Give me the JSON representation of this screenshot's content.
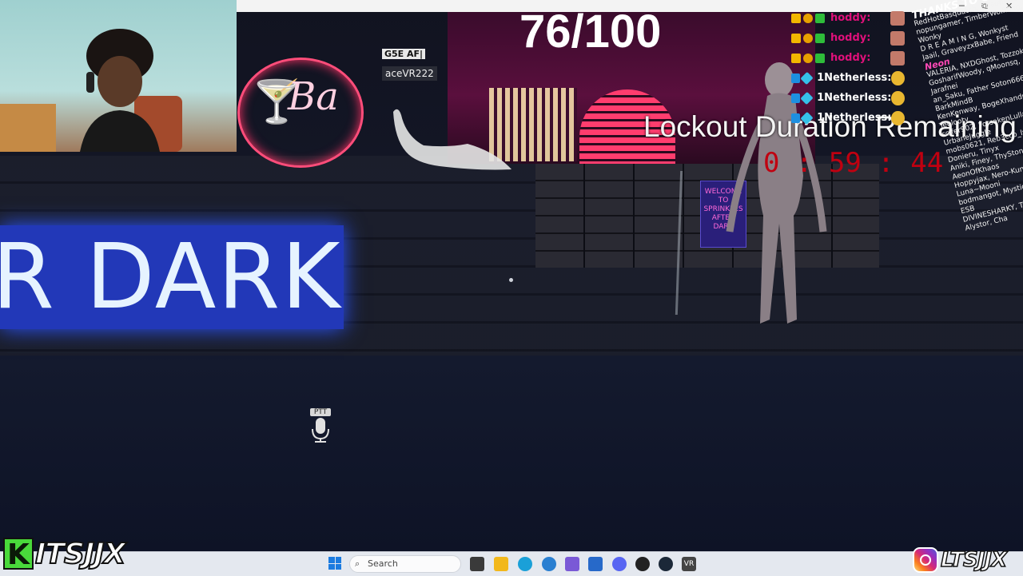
{
  "window": {
    "minimize": "─",
    "maximize": "⧉",
    "close": "✕"
  },
  "game": {
    "score": "76/100",
    "lockout_label": "Lockout Duration Remaining",
    "timer": "0 : 59 : 44",
    "bar_sign_script": "Ba",
    "dark_sign": "R DARK",
    "player_tag_short": "G5E AF|",
    "player_tag_name": "aceVR222",
    "poster_text": "WELCOME TO SPRINKLES AFTER DARK",
    "ptt_label": "PTT"
  },
  "chat": {
    "messages": [
      {
        "user": "hoddy:",
        "color": "#e0107a",
        "badge": "crown"
      },
      {
        "user": "hoddy:",
        "color": "#e0107a",
        "badge": "crown"
      },
      {
        "user": "hoddy:",
        "color": "#e0107a",
        "badge": "crown"
      },
      {
        "user": "1Netherless:",
        "color": "#ffffff",
        "badge": "diamond"
      },
      {
        "user": "1Netherless:",
        "color": "#ffffff",
        "badge": "diamond"
      },
      {
        "user": "1Netherless:",
        "color": "#ffffff",
        "badge": "diamond"
      }
    ]
  },
  "thanks": {
    "header": "THANKS TO OUR",
    "names_1": "RedHotBasquatch, Chaotic Vai",
    "names_2": "nopungamer, TimberWolfKing, Wonky",
    "names_3": "D R E A M I N G, Wonkyst",
    "names_4": "Jaail, GraveyzxBabe, Friend",
    "neon": "Neon",
    "names_5": "VALERIA, NXDGhost, Tozzok",
    "names_6": "GosharifWoody, qMoonsq, Jarafnei",
    "names_7": "an_Saku, Father Soton666, BarkMindB",
    "names_8": "KenKenway, BogeXhandr, Teolooty",
    "names_9": "scifer902, ForsakenLullaby, UrbaneJuggle",
    "names_10": "mobs0621, Reb3cco_lynn, Donieru, Tinyx",
    "names_11": "Aniki, Finey, ThyStonerGirl, AeonOfKhaos",
    "names_12": "Hoppyjax, Nero-Kun, xBrimx, Luna~Mooni",
    "names_13": "bodmangot, Mystique_Widow, ESB",
    "names_14": "DIVINESHARKY, TrashyPanda, Alystor, Cha"
  },
  "taskbar": {
    "search_placeholder": "Search"
  },
  "branding": {
    "left_letter": "K",
    "left_name": "ITSJJX",
    "right_name": "LTSJJX"
  }
}
